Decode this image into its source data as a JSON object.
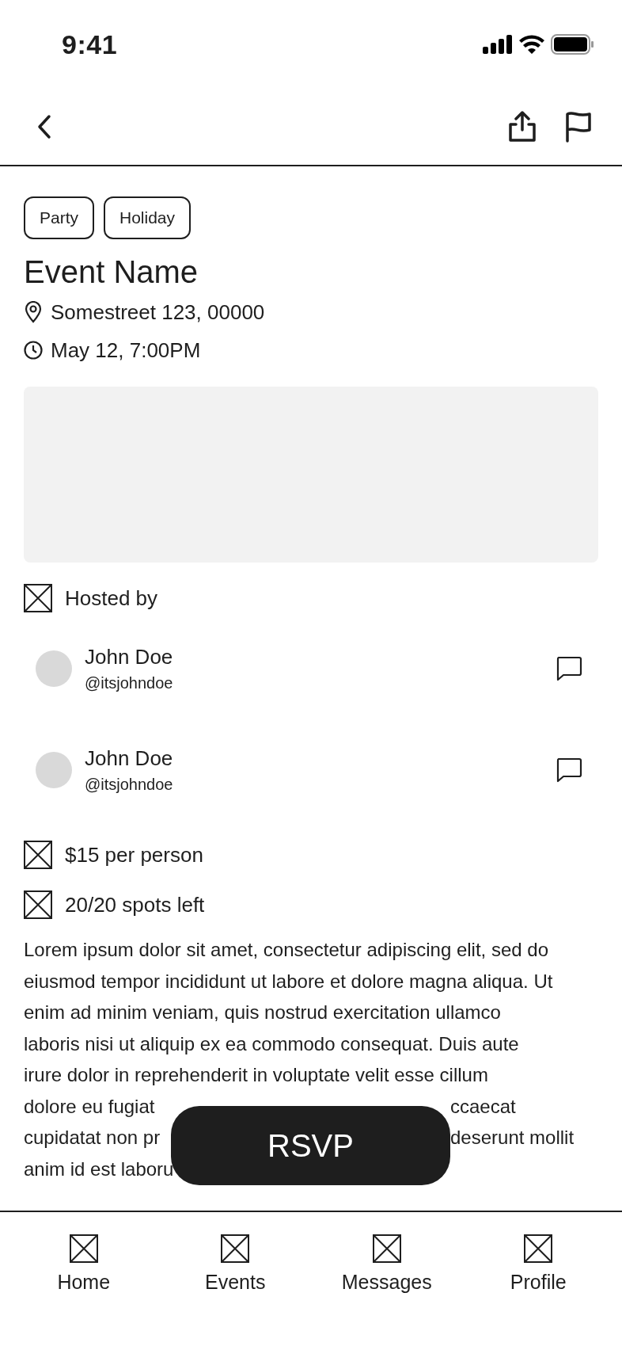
{
  "status_bar": {
    "time": "9:41"
  },
  "tags": [
    {
      "label": "Party"
    },
    {
      "label": "Holiday"
    }
  ],
  "event": {
    "title": "Event Name",
    "address": "Somestreet 123, 00000",
    "datetime": "May 12, 7:00PM"
  },
  "hosted_by": "Hosted by",
  "hosts": [
    {
      "name": "John Doe",
      "handle": "@itsjohndoe"
    },
    {
      "name": "John Doe",
      "handle": "@itsjohndoe"
    }
  ],
  "details": [
    {
      "text": "$15 per person"
    },
    {
      "text": "20/20 spots left"
    }
  ],
  "description_lines": [
    {
      "text": "Lorem ipsum dolor sit amet, consectetur adipiscing elit, sed do"
    },
    {
      "text": "eiusmod tempor incididunt ut labore et dolore magna aliqua. Ut"
    },
    {
      "text": "enim ad minim veniam, quis nostrud exercitation ullamco"
    },
    {
      "text": "laboris nisi ut aliquip ex ea commodo consequat. Duis aute"
    },
    {
      "text": "irure dolor in reprehenderit in voluptate velit esse cillum"
    },
    {
      "text": "dolore eu fugiat",
      "text_after_button": "ccaecat"
    },
    {
      "text": "cupidatat non pr",
      "text_after_button": "deserunt mollit"
    },
    {
      "text": "anim id est laboru"
    }
  ],
  "rsvp_button": "RSVP",
  "tab_bar": [
    {
      "label": "Home"
    },
    {
      "label": "Events"
    },
    {
      "label": "Messages"
    },
    {
      "label": "Profile"
    }
  ]
}
